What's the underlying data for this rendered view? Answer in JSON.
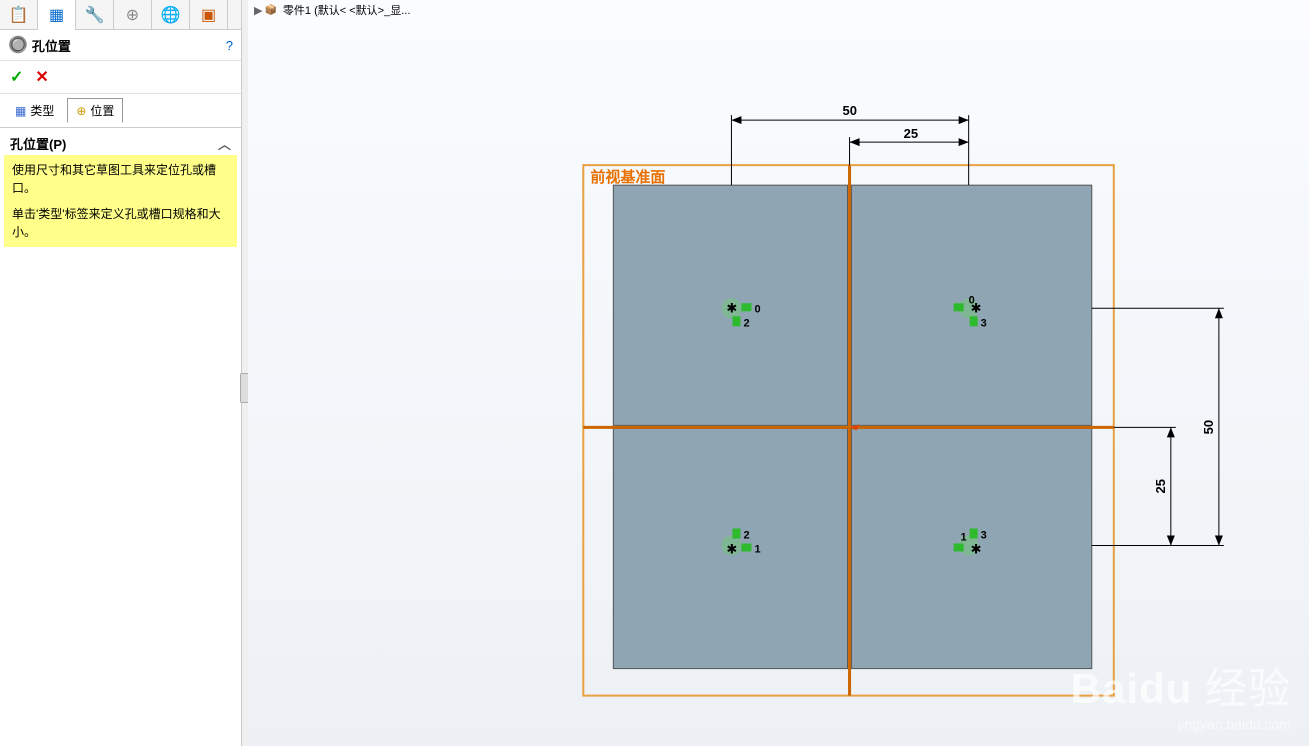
{
  "feature": {
    "title": "孔位置",
    "help_symbol": "?",
    "icon_label": "孔"
  },
  "buttons": {
    "ok": "✓",
    "cancel": "✕"
  },
  "sub_tabs": {
    "type_label": "类型",
    "position_label": "位置"
  },
  "section": {
    "title": "孔位置(P)",
    "chevron": "︿",
    "info_line1": "使用尺寸和其它草图工具来定位孔或槽口。",
    "info_line2": "单击'类型'标签来定义孔或槽口规格和大小。"
  },
  "top_tab": {
    "arrow": "▶",
    "item_icon": "📦",
    "label": "零件1  (默认< <默认>_显..."
  },
  "drawing": {
    "plane_label": "前视基准面",
    "dims": {
      "d50": "50",
      "d25_h": "25",
      "d50_v": "50",
      "d25_v": "25"
    },
    "points": {
      "p1": {
        "main": "0",
        "sub": "2"
      },
      "p2": {
        "main": "0",
        "sub": "3"
      },
      "p3": {
        "main": "2",
        "sub": "1"
      },
      "p4": {
        "main": "3",
        "sub": "1"
      }
    }
  },
  "watermark": {
    "brand": "Baidu",
    "suffix": "经验",
    "url": "jingyan.baidu.com"
  }
}
